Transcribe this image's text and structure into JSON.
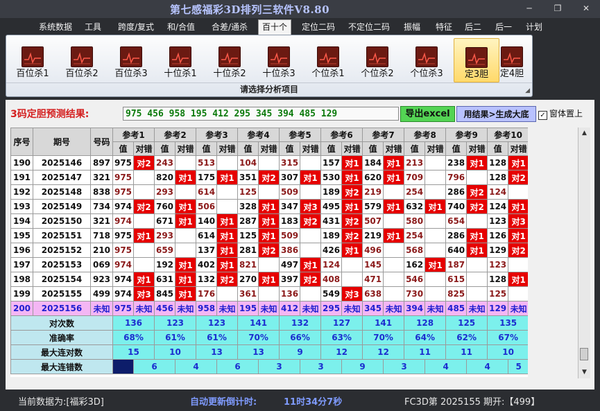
{
  "window": {
    "title": "第七感福彩3D排列三软件V8.80",
    "minimize": "─",
    "restore": "❐",
    "close": "✕"
  },
  "menu": [
    {
      "label": "系统数据"
    },
    {
      "label": "工具"
    },
    {
      "label": "跨度/复式"
    },
    {
      "label": "和/合值"
    },
    {
      "label": "合差/通杀"
    },
    {
      "label": "百十个"
    },
    {
      "label": "定位二码"
    },
    {
      "label": "不定位二码"
    },
    {
      "label": "振幅"
    },
    {
      "label": "特征"
    },
    {
      "label": "后二"
    },
    {
      "label": "后一"
    },
    {
      "label": "计划"
    }
  ],
  "menu_active": "百十个",
  "ribbon": {
    "caption": "请选择分析项目",
    "buttons": [
      {
        "label": "百位杀1"
      },
      {
        "label": "百位杀2"
      },
      {
        "label": "百位杀3"
      },
      {
        "label": "十位杀1"
      },
      {
        "label": "十位杀2"
      },
      {
        "label": "十位杀3"
      },
      {
        "label": "个位杀1"
      },
      {
        "label": "个位杀2"
      },
      {
        "label": "个位杀3"
      },
      {
        "label": "定3胆"
      },
      {
        "label": "定4胆"
      }
    ],
    "selected": "定3胆"
  },
  "prediction": {
    "label": "3码定胆预测结果:",
    "value": "975 456 958 195 412 295 345 394 485 129",
    "export_button": "导出excel",
    "generate_button": "用结果>生成大底",
    "checkbox_checked": "✓",
    "checkbox_label": "窗体置上"
  },
  "table": {
    "headers": {
      "seq": "序号",
      "period": "期号",
      "number": "号码"
    },
    "refs": [
      "参考1",
      "参考2",
      "参考3",
      "参考4",
      "参考5",
      "参考6",
      "参考7",
      "参考8",
      "参考9",
      "参考10"
    ],
    "sub_value": "值",
    "sub_check": "对错",
    "rows": [
      {
        "seq": "190",
        "period": "2025146",
        "number": "897",
        "cells": [
          [
            "975",
            "对2"
          ],
          [
            "243",
            ""
          ],
          [
            "513",
            ""
          ],
          [
            "104",
            ""
          ],
          [
            "315",
            ""
          ],
          [
            "157",
            "对1"
          ],
          [
            "184",
            "对1"
          ],
          [
            "213",
            ""
          ],
          [
            "238",
            "对1"
          ],
          [
            "128",
            "对1"
          ]
        ]
      },
      {
        "seq": "191",
        "period": "2025147",
        "number": "321",
        "cells": [
          [
            "975",
            ""
          ],
          [
            "820",
            "对1"
          ],
          [
            "175",
            "对1"
          ],
          [
            "351",
            "对2"
          ],
          [
            "307",
            "对1"
          ],
          [
            "530",
            "对1"
          ],
          [
            "620",
            "对1"
          ],
          [
            "709",
            ""
          ],
          [
            "796",
            ""
          ],
          [
            "128",
            "对2"
          ]
        ]
      },
      {
        "seq": "192",
        "period": "2025148",
        "number": "838",
        "cells": [
          [
            "975",
            ""
          ],
          [
            "293",
            ""
          ],
          [
            "614",
            ""
          ],
          [
            "125",
            ""
          ],
          [
            "509",
            ""
          ],
          [
            "189",
            "对2"
          ],
          [
            "219",
            ""
          ],
          [
            "254",
            ""
          ],
          [
            "286",
            "对2"
          ],
          [
            "124",
            ""
          ]
        ]
      },
      {
        "seq": "193",
        "period": "2025149",
        "number": "734",
        "cells": [
          [
            "974",
            "对2"
          ],
          [
            "760",
            "对1"
          ],
          [
            "506",
            ""
          ],
          [
            "328",
            "对1"
          ],
          [
            "347",
            "对3"
          ],
          [
            "495",
            "对1"
          ],
          [
            "579",
            "对1"
          ],
          [
            "632",
            "对1"
          ],
          [
            "740",
            "对2"
          ],
          [
            "124",
            "对1"
          ]
        ]
      },
      {
        "seq": "194",
        "period": "2025150",
        "number": "321",
        "cells": [
          [
            "974",
            ""
          ],
          [
            "671",
            "对1"
          ],
          [
            "140",
            "对1"
          ],
          [
            "287",
            "对1"
          ],
          [
            "183",
            "对2"
          ],
          [
            "431",
            "对2"
          ],
          [
            "507",
            ""
          ],
          [
            "580",
            ""
          ],
          [
            "654",
            ""
          ],
          [
            "123",
            "对3"
          ]
        ]
      },
      {
        "seq": "195",
        "period": "2025151",
        "number": "718",
        "cells": [
          [
            "975",
            "对1"
          ],
          [
            "293",
            ""
          ],
          [
            "614",
            "对1"
          ],
          [
            "125",
            "对1"
          ],
          [
            "509",
            ""
          ],
          [
            "189",
            "对2"
          ],
          [
            "219",
            "对1"
          ],
          [
            "254",
            ""
          ],
          [
            "286",
            "对1"
          ],
          [
            "126",
            "对1"
          ]
        ]
      },
      {
        "seq": "196",
        "period": "2025152",
        "number": "210",
        "cells": [
          [
            "975",
            ""
          ],
          [
            "659",
            ""
          ],
          [
            "137",
            "对1"
          ],
          [
            "281",
            "对2"
          ],
          [
            "386",
            ""
          ],
          [
            "426",
            "对1"
          ],
          [
            "496",
            ""
          ],
          [
            "568",
            ""
          ],
          [
            "640",
            "对1"
          ],
          [
            "129",
            "对2"
          ]
        ]
      },
      {
        "seq": "197",
        "period": "2025153",
        "number": "069",
        "cells": [
          [
            "974",
            ""
          ],
          [
            "192",
            "对1"
          ],
          [
            "402",
            "对1"
          ],
          [
            "821",
            ""
          ],
          [
            "497",
            "对1"
          ],
          [
            "124",
            ""
          ],
          [
            "145",
            ""
          ],
          [
            "162",
            "对1"
          ],
          [
            "187",
            ""
          ],
          [
            "123",
            ""
          ]
        ]
      },
      {
        "seq": "198",
        "period": "2025154",
        "number": "923",
        "cells": [
          [
            "974",
            "对1"
          ],
          [
            "631",
            "对1"
          ],
          [
            "132",
            "对2"
          ],
          [
            "270",
            "对1"
          ],
          [
            "397",
            "对2"
          ],
          [
            "408",
            ""
          ],
          [
            "471",
            ""
          ],
          [
            "546",
            ""
          ],
          [
            "615",
            ""
          ],
          [
            "128",
            "对1"
          ]
        ]
      },
      {
        "seq": "199",
        "period": "2025155",
        "number": "499",
        "cells": [
          [
            "974",
            "对3"
          ],
          [
            "845",
            "对1"
          ],
          [
            "176",
            ""
          ],
          [
            "361",
            ""
          ],
          [
            "136",
            ""
          ],
          [
            "549",
            "对3"
          ],
          [
            "638",
            ""
          ],
          [
            "730",
            ""
          ],
          [
            "825",
            ""
          ],
          [
            "125",
            ""
          ]
        ]
      }
    ],
    "forecast_row": {
      "seq": "200",
      "period": "2025156",
      "number": "未知",
      "values": [
        "975",
        "456",
        "958",
        "195",
        "412",
        "295",
        "345",
        "394",
        "485",
        "129"
      ],
      "unknown": "未知"
    },
    "stats": [
      {
        "label": "对次数",
        "values": [
          "136",
          "123",
          "123",
          "141",
          "132",
          "127",
          "141",
          "128",
          "125",
          "135"
        ]
      },
      {
        "label": "准确率",
        "values": [
          "68%",
          "61%",
          "61%",
          "70%",
          "66%",
          "63%",
          "70%",
          "64%",
          "62%",
          "67%"
        ]
      },
      {
        "label": "最大连对数",
        "values": [
          "15",
          "10",
          "13",
          "13",
          "9",
          "12",
          "12",
          "11",
          "11",
          "10"
        ]
      },
      {
        "label": "最大连错数",
        "values": [
          "",
          "6",
          "4",
          "6",
          "3",
          "3",
          "9",
          "3",
          "4",
          "4",
          "5"
        ]
      }
    ]
  },
  "colors": {
    "hit": "#e60000",
    "value_normal": "#111111",
    "value_miss": "#8b1a1a",
    "forecast_bg": "#f4b6f4",
    "stat_bg": "#7cf0ec",
    "stat_text": "#1c2ecf"
  },
  "status": {
    "current_label": "当前数据为:[福彩3D]",
    "countdown_label": "自动更新倒计时:",
    "countdown_value": "11时34分7秒",
    "lottery_info": "FC3D第 2025155 期开:【499】"
  }
}
